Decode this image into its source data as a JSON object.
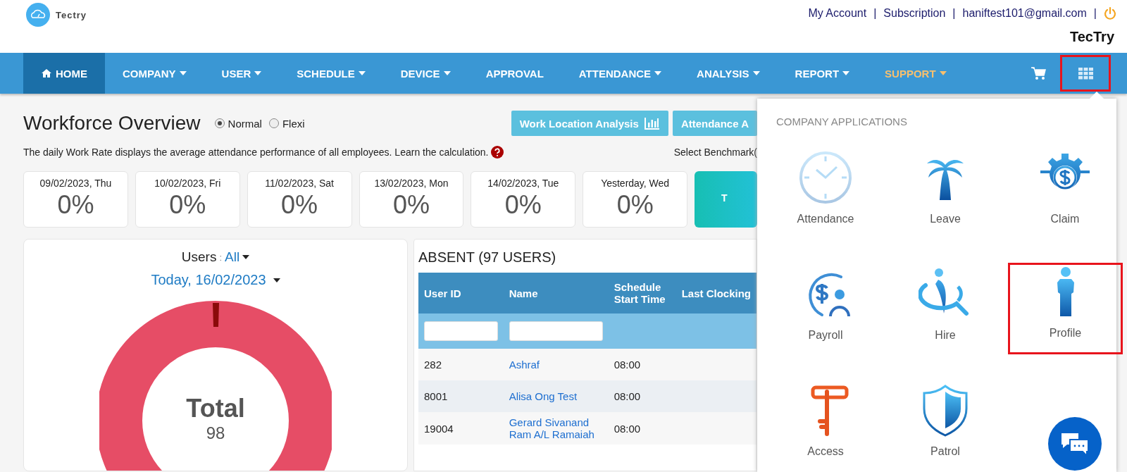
{
  "header": {
    "logo_text": "Tectry",
    "links": [
      "My Account",
      "Subscription",
      "haniftest101@gmail.com"
    ],
    "separator": "|",
    "company": "TecTry"
  },
  "nav": {
    "items": [
      {
        "label": "HOME",
        "selected": true,
        "caret": false,
        "color": "#ffffff"
      },
      {
        "label": "COMPANY",
        "selected": false,
        "caret": true,
        "color": "#ffffff"
      },
      {
        "label": "USER",
        "selected": false,
        "caret": true,
        "color": "#ffffff"
      },
      {
        "label": "SCHEDULE",
        "selected": false,
        "caret": true,
        "color": "#ffffff"
      },
      {
        "label": "DEVICE",
        "selected": false,
        "caret": true,
        "color": "#ffffff"
      },
      {
        "label": "APPROVAL",
        "selected": false,
        "caret": false,
        "color": "#ffffff"
      },
      {
        "label": "ATTENDANCE",
        "selected": false,
        "caret": true,
        "color": "#ffffff"
      },
      {
        "label": "ANALYSIS",
        "selected": false,
        "caret": true,
        "color": "#ffffff"
      },
      {
        "label": "REPORT",
        "selected": false,
        "caret": true,
        "color": "#ffffff"
      },
      {
        "label": "SUPPORT",
        "selected": false,
        "caret": true,
        "color": "#f7c06e"
      }
    ],
    "apps_button": {
      "highlighted": true
    }
  },
  "overview": {
    "title": "Workforce Overview",
    "modes": [
      {
        "label": "Normal",
        "selected": true
      },
      {
        "label": "Flexi",
        "selected": false
      }
    ],
    "buttons": [
      "Work Location Analysis",
      "Attendance A"
    ],
    "description": "The daily Work Rate displays the average attendance performance of all employees. Learn the calculation.",
    "benchmark_label": "Select Benchmark(",
    "days": [
      {
        "date": "09/02/2023, Thu",
        "rate": "0%"
      },
      {
        "date": "10/02/2023, Fri",
        "rate": "0%"
      },
      {
        "date": "11/02/2023, Sat",
        "rate": "0%"
      },
      {
        "date": "13/02/2023, Mon",
        "rate": "0%"
      },
      {
        "date": "14/02/2023, Tue",
        "rate": "0%"
      },
      {
        "date": "Yesterday, Wed",
        "rate": "0%"
      }
    ],
    "today_card": "T"
  },
  "users_panel": {
    "users_label": "Users",
    "users_sep": ":",
    "users_value": "All",
    "date": "Today, 16/02/2023",
    "total_label": "Total",
    "total_value": "98"
  },
  "absent": {
    "title": "ABSENT (97 USERS)",
    "columns": [
      {
        "label": "User ID",
        "filter": true
      },
      {
        "label": "Name",
        "filter": true
      },
      {
        "label": "Schedule Start Time",
        "filter": false
      },
      {
        "label": "Last Clocking",
        "filter": false
      }
    ],
    "rows": [
      [
        "282",
        "Ashraf",
        "08:00",
        ""
      ],
      [
        "8001",
        "Alisa Ong Test",
        "08:00",
        ""
      ],
      [
        "19004",
        "Gerard Sivanand Ram A/L Ramaiah",
        "08:00",
        ""
      ]
    ]
  },
  "apps_menu": {
    "heading": "COMPANY APPLICATIONS",
    "items": [
      {
        "label": "Attendance",
        "kind": "clock",
        "highlighted": false
      },
      {
        "label": "Leave",
        "kind": "palm",
        "highlighted": false
      },
      {
        "label": "Claim",
        "kind": "claim",
        "highlighted": false
      },
      {
        "label": "Payroll",
        "kind": "payroll",
        "highlighted": false
      },
      {
        "label": "Hire",
        "kind": "hire",
        "highlighted": false
      },
      {
        "label": "Profile",
        "kind": "person",
        "highlighted": true
      },
      {
        "label": "Access",
        "kind": "key",
        "highlighted": false
      },
      {
        "label": "Patrol",
        "kind": "shield",
        "highlighted": false
      }
    ]
  }
}
